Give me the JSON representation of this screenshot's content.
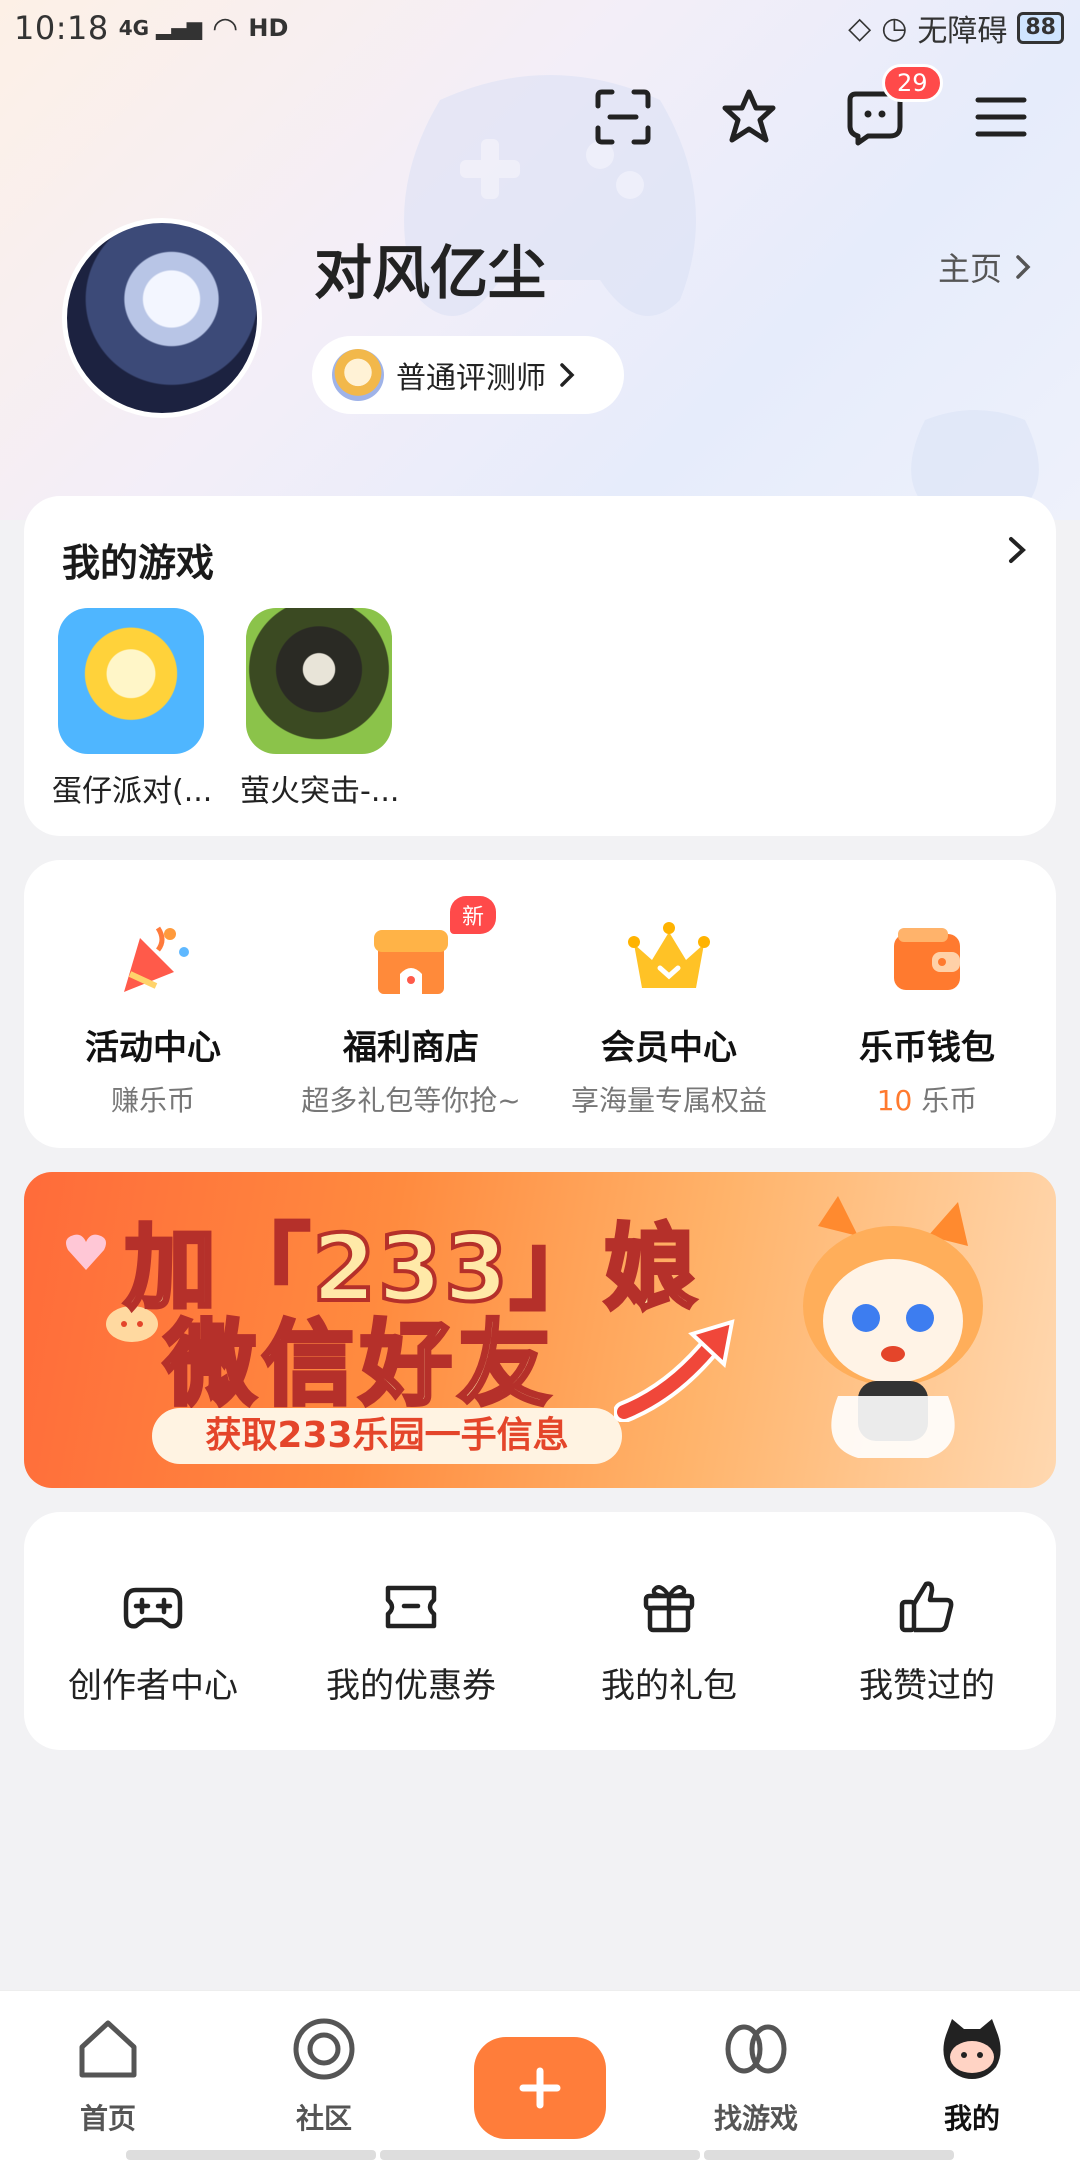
{
  "status_bar": {
    "time": "10:18",
    "network": "4G",
    "hd": "HD",
    "accessibility": "无障碍",
    "battery": "88"
  },
  "header": {
    "message_count": "29",
    "username": "对风亿尘",
    "homepage_label": "主页",
    "role_label": "普通评测师"
  },
  "my_games": {
    "title": "我的游戏",
    "games": [
      {
        "name": "蛋仔派对(..."
      },
      {
        "name": "萤火突击-..."
      }
    ]
  },
  "features": [
    {
      "title": "活动中心",
      "subtitle": "赚乐币",
      "icon": "party-popper-icon"
    },
    {
      "title": "福利商店",
      "subtitle": "超多礼包等你抢~",
      "badge": "新",
      "icon": "shop-icon"
    },
    {
      "title": "会员中心",
      "subtitle": "享海量专属权益",
      "icon": "crown-icon"
    },
    {
      "title": "乐币钱包",
      "subtitle_value": "10",
      "subtitle_unit": " 乐币",
      "icon": "wallet-icon"
    }
  ],
  "banner": {
    "line1": "加「233」娘",
    "line2": "微信好友",
    "line3": "获取233乐园一手信息"
  },
  "tools": [
    {
      "label": "创作者中心",
      "icon": "gamepad-plus-icon"
    },
    {
      "label": "我的优惠券",
      "icon": "coupon-icon"
    },
    {
      "label": "我的礼包",
      "icon": "gift-icon"
    },
    {
      "label": "我赞过的",
      "icon": "thumbs-up-icon"
    }
  ],
  "tabbar": {
    "home": "首页",
    "community": "社区",
    "find_games": "找游戏",
    "mine": "我的",
    "active": "mine"
  },
  "colors": {
    "accent": "#ff7d3a",
    "badge": "#ff4a4a"
  }
}
